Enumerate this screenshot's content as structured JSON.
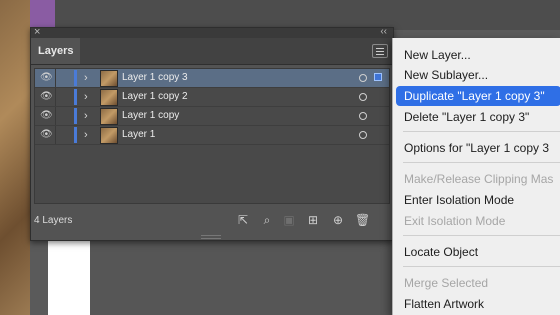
{
  "panel": {
    "tab_label": "Layers",
    "layers": [
      {
        "name": "Layer 1 copy 3",
        "selected": true
      },
      {
        "name": "Layer 1 copy 2",
        "selected": false
      },
      {
        "name": "Layer 1 copy",
        "selected": false
      },
      {
        "name": "Layer 1",
        "selected": false
      }
    ],
    "layer_count": "4 Layers"
  },
  "menu": {
    "items": [
      "New Layer...",
      "New Sublayer...",
      "Duplicate \"Layer 1 copy 3\"",
      "Delete \"Layer 1 copy 3\"",
      "Options for \"Layer 1 copy 3",
      "Make/Release Clipping Mas",
      "Enter Isolation Mode",
      "Exit Isolation Mode",
      "Locate Object",
      "Merge Selected",
      "Flatten Artwork"
    ],
    "highlighted_index": 2,
    "disabled_indices": [
      5,
      7,
      9
    ]
  },
  "colors": {
    "accent_blue": "#2f6fe6",
    "layer_color": "#4a7bd8",
    "panel_bg": "#535353"
  },
  "icons": [
    "eye-icon",
    "chevron-right-icon",
    "export-icon",
    "search-icon",
    "collect-icon",
    "new-sublayer-icon",
    "new-layer-icon",
    "trash-icon"
  ]
}
